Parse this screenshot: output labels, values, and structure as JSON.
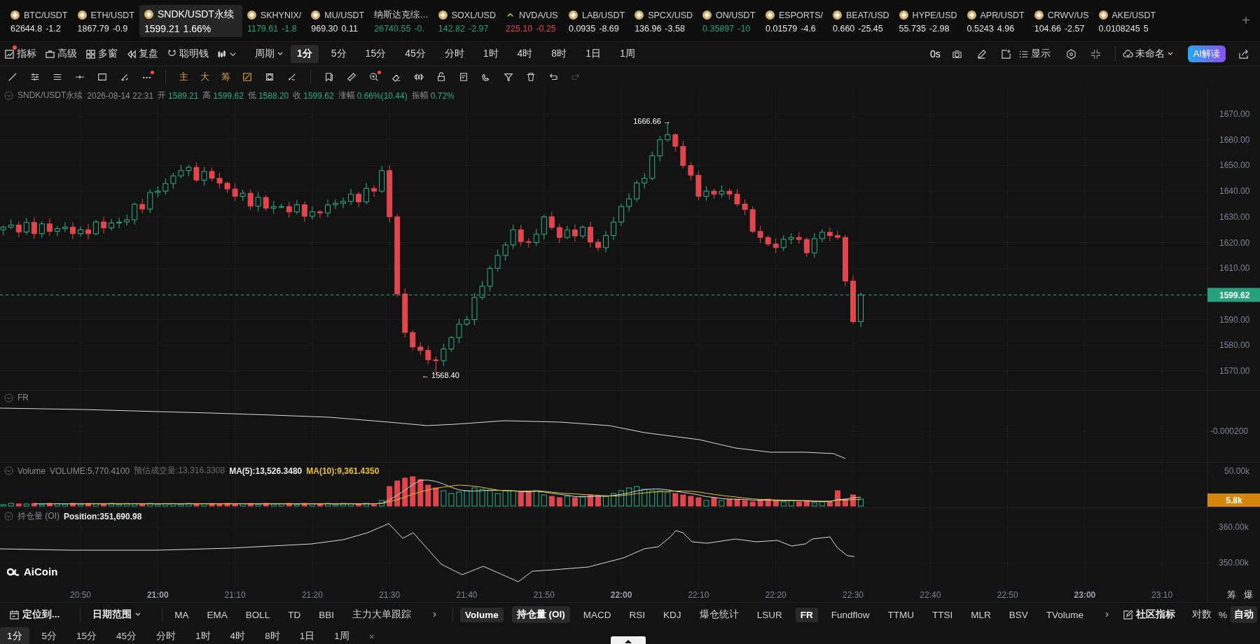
{
  "tickers": [
    {
      "symbol": "BTC/USDT",
      "price": "62644.8",
      "change": "-1.2",
      "color": "#e6e6e6",
      "selected": false
    },
    {
      "symbol": "ETH/USDT",
      "price": "1867.79",
      "change": "-0.9",
      "color": "#e6e6e6",
      "selected": false
    },
    {
      "symbol": "SNDK/USDT永续",
      "price": "1599.21",
      "change": "1.66%",
      "color": "#ffffff",
      "selected": true
    },
    {
      "symbol": "SKHYNIX/",
      "price": "1179.61",
      "change": "-1.8",
      "color": "#24a47a",
      "selected": false
    },
    {
      "symbol": "MU/USDT",
      "price": "969.30",
      "change": "0.11",
      "color": "#e6e6e6",
      "selected": false
    },
    {
      "symbol": "纳斯达克综…",
      "price": "26740.55",
      "change": "-0.",
      "color": "#24a47a",
      "selected": false
    },
    {
      "symbol": "SOXL/USD",
      "price": "142.82",
      "change": "-2.97",
      "color": "#24a47a",
      "selected": false
    },
    {
      "symbol": "NVDA/US",
      "price": "225.10",
      "change": "-0.25",
      "color": "#e0474c",
      "selected": false
    },
    {
      "symbol": "LAB/USDT",
      "price": "0.0935",
      "change": "-8.69",
      "color": "#e6e6e6",
      "selected": false
    },
    {
      "symbol": "SPCX/USD",
      "price": "136.96",
      "change": "-3.58",
      "color": "#e6e6e6",
      "selected": false
    },
    {
      "symbol": "ON/USDT",
      "price": "0.35897",
      "change": "-10",
      "color": "#24a47a",
      "selected": false
    },
    {
      "symbol": "ESPORTS/",
      "price": "0.01579",
      "change": "-4.6",
      "color": "#e6e6e6",
      "selected": false
    },
    {
      "symbol": "BEAT/USD",
      "price": "0.660",
      "change": "-25.45",
      "color": "#e6e6e6",
      "selected": false
    },
    {
      "symbol": "HYPE/USD",
      "price": "55.735",
      "change": "-2.98",
      "color": "#e6e6e6",
      "selected": false
    },
    {
      "symbol": "APR/USDT",
      "price": "0.5243",
      "change": "4.96",
      "color": "#e6e6e6",
      "selected": false
    },
    {
      "symbol": "CRWV/US",
      "price": "104.66",
      "change": "-2.57",
      "color": "#e6e6e6",
      "selected": false
    },
    {
      "symbol": "AKE/USDT",
      "price": "0.0108245",
      "change": "5",
      "color": "#e6e6e6",
      "selected": false
    }
  ],
  "ticker_add": "+",
  "toolbar": {
    "tools": [
      {
        "label": "指标",
        "badge": true
      },
      {
        "label": "高级",
        "badge": false
      },
      {
        "label": "多窗",
        "badge": false
      },
      {
        "label": "复盘",
        "badge": false
      },
      {
        "label": "聪明钱",
        "badge": false
      }
    ],
    "period_label": "周期",
    "periods": [
      {
        "label": "1分",
        "selected": true
      },
      {
        "label": "5分",
        "selected": false
      },
      {
        "label": "15分",
        "selected": false
      },
      {
        "label": "45分",
        "selected": false
      },
      {
        "label": "分时",
        "selected": false
      },
      {
        "label": "1时",
        "selected": false
      },
      {
        "label": "4时",
        "selected": false
      },
      {
        "label": "8时",
        "selected": false
      },
      {
        "label": "1日",
        "selected": false
      },
      {
        "label": "1周",
        "selected": false
      }
    ],
    "timer": "0s",
    "display": "显示",
    "layout_name": "未命名",
    "ai": "AI解读"
  },
  "drawing_toolbar": {
    "text_tools": [
      "主",
      "大",
      "筹"
    ],
    "more_badge": true,
    "zoom_badge": true,
    "redo_disabled": true
  },
  "main_chart": {
    "symbol": "SNDK/USDT永续",
    "time": "2026-08-14 22:31",
    "stats": [
      {
        "label": "开",
        "value": "1589.21"
      },
      {
        "label": "高",
        "value": "1599.62"
      },
      {
        "label": "低",
        "value": "1588.20"
      },
      {
        "label": "收",
        "value": "1599.62"
      },
      {
        "label": "涨幅",
        "value": "0.66%(10.44)"
      },
      {
        "label": "振幅",
        "value": "0.72%"
      }
    ],
    "price_ticks": [
      "1670.00",
      "1660.00",
      "1650.00",
      "1640.00",
      "1630.00",
      "1620.00",
      "1610.00",
      "1590.00",
      "1580.00",
      "1570.00"
    ],
    "last_price": "1599.62",
    "high_marker": "1666.66 →",
    "low_marker": "← 1568.40"
  },
  "fr_pane": {
    "label": "FR",
    "ticks": [
      "-0.000200"
    ]
  },
  "volume_pane": {
    "label": "Volume",
    "volume": "VOLUME:5,770.4100",
    "estimate": "预估成交量:13,316.3308",
    "ma5": "MA(5):13,526.3480",
    "ma10": "MA(10):9,361.4350",
    "ticks": [
      "50.00k"
    ],
    "current": "5.8k"
  },
  "oi_pane": {
    "label": "持仓量 (OI)",
    "position": "Position:351,690.98",
    "ticks": [
      "360.00k",
      "350.00k"
    ]
  },
  "logo": "AiCoin",
  "time_axis": [
    {
      "label": "20:50",
      "bold": false
    },
    {
      "label": "21:00",
      "bold": true
    },
    {
      "label": "21:10",
      "bold": false
    },
    {
      "label": "21:20",
      "bold": false
    },
    {
      "label": "21:30",
      "bold": false
    },
    {
      "label": "21:40",
      "bold": false
    },
    {
      "label": "21:50",
      "bold": false
    },
    {
      "label": "22:00",
      "bold": true
    },
    {
      "label": "22:10",
      "bold": false
    },
    {
      "label": "22:20",
      "bold": false
    },
    {
      "label": "22:30",
      "bold": false
    },
    {
      "label": "22:40",
      "bold": false
    },
    {
      "label": "22:50",
      "bold": false
    },
    {
      "label": "23:00",
      "bold": true
    },
    {
      "label": "23:10",
      "bold": false
    }
  ],
  "axis_extras": [
    "筹",
    "爆"
  ],
  "bottom_bar": {
    "locate": "定位到...",
    "date_range": "日期范围",
    "main_indicators": [
      "MA",
      "EMA",
      "BOLL",
      "TD",
      "BBI",
      "主力大单跟踪"
    ],
    "sub_indicators": [
      {
        "label": "Volume",
        "selected": true
      },
      {
        "label": "持仓量 (OI)",
        "selected": true
      },
      {
        "label": "MACD",
        "selected": false
      },
      {
        "label": "RSI",
        "selected": false
      },
      {
        "label": "KDJ",
        "selected": false
      },
      {
        "label": "爆仓统计",
        "selected": false
      },
      {
        "label": "LSUR",
        "selected": false
      },
      {
        "label": "FR",
        "selected": true
      },
      {
        "label": "Fundflow",
        "selected": false
      },
      {
        "label": "TTMU",
        "selected": false
      },
      {
        "label": "TTSI",
        "selected": false
      },
      {
        "label": "MLR",
        "selected": false
      },
      {
        "label": "BSV",
        "selected": false
      },
      {
        "label": "TVolume",
        "selected": false
      }
    ],
    "community": "社区指标",
    "scale_options": [
      {
        "label": "对数",
        "selected": false
      },
      {
        "label": "%",
        "selected": false
      },
      {
        "label": "自动",
        "selected": true
      }
    ]
  },
  "period_bar": {
    "periods": [
      {
        "label": "1分",
        "selected": true
      },
      {
        "label": "5分",
        "selected": false
      },
      {
        "label": "15分",
        "selected": false
      },
      {
        "label": "45分",
        "selected": false
      },
      {
        "label": "分时",
        "selected": false
      },
      {
        "label": "1时",
        "selected": false
      },
      {
        "label": "4时",
        "selected": false
      },
      {
        "label": "8时",
        "selected": false
      },
      {
        "label": "1日",
        "selected": false
      },
      {
        "label": "1周",
        "selected": false
      }
    ],
    "close": "×"
  }
}
